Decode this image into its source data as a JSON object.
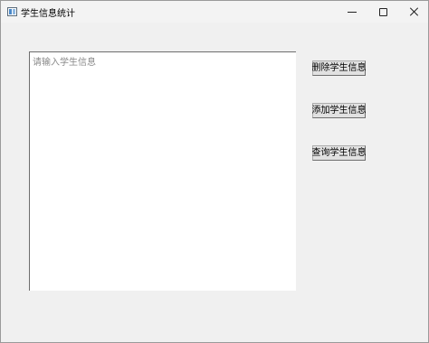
{
  "window": {
    "title": "学生信息统计"
  },
  "titlebar": {
    "icons": {
      "app": "window-app-icon",
      "minimize": "minimize-icon",
      "maximize": "maximize-icon",
      "close": "close-icon"
    }
  },
  "main": {
    "input": {
      "placeholder": "请输入学生信息",
      "value": ""
    },
    "buttons": {
      "delete_label": "删除学生信息",
      "add_label": "添加学生信息",
      "query_label": "查询学生信息"
    }
  }
}
